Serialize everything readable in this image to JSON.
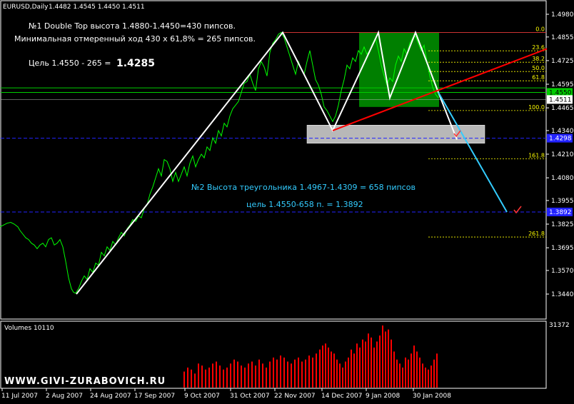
{
  "header": {
    "symbol_label": "EURUSD,Daily",
    "ohlc": "1.4482 1.4545 1.4450 1.4511"
  },
  "annotations": {
    "line1": "№1 Double Top высота 1.4880-1.4450=430 пипсов.",
    "line2": "Минимальная отмеренный ход 430 х 61,8% = 265 пипсов.",
    "target1_prefix": "Цель 1.4550 - 265 =",
    "target1_value": "1.4285",
    "line3": "№2 Высота треугольника 1.4967-1.4309 = 658 пипсов",
    "line4": "цель 1.4550-658 п. = 1.3892"
  },
  "site_label": "WWW.GIVI-ZURABOVICH.RU",
  "volume_label": "Volumes 10110",
  "colors": {
    "background": "#000000",
    "price": "#00ff00",
    "grid": "#ffffff",
    "pattern": "#ffffff",
    "trendline": "#ff0000",
    "projection": "#33ccff",
    "zone_green": "#00aa00",
    "zone_grey": "#d8d8d8",
    "fib": "#ffff00",
    "volume": "#ff0000",
    "blue_level": "#3333ff",
    "tag_green": "#00cc00",
    "tag_blue": "#2222ff"
  },
  "chart_data": {
    "type": "line",
    "title": "EURUSD,Daily",
    "ylim": [
      1.332,
      1.5
    ],
    "x_ticks": [
      "11 Jul 2007",
      "2 Aug 2007",
      "24 Aug 2007",
      "17 Sep 2007",
      "9 Oct 2007",
      "31 Oct 2007",
      "22 Nov 2007",
      "14 Dec 2007",
      "9 Jan 2008",
      "30 Jan 2008"
    ],
    "y_ticks": [
      "1.4980",
      "1.4855",
      "1.4725",
      "1.4595",
      "1.4465",
      "1.4340",
      "1.4210",
      "1.4080",
      "1.3955",
      "1.3825",
      "1.3695",
      "1.3570",
      "1.3440"
    ],
    "y_tick_values": [
      1.498,
      1.4855,
      1.4725,
      1.4595,
      1.4465,
      1.434,
      1.421,
      1.408,
      1.3955,
      1.3825,
      1.3695,
      1.357,
      1.344
    ],
    "tags": [
      {
        "label": "1.4550",
        "value": 1.455,
        "color": "#00cc00",
        "kind": "hline"
      },
      {
        "label": "1.4511",
        "value": 1.4511,
        "color": "#ffffff",
        "kind": "price"
      },
      {
        "label": "1.4298",
        "value": 1.4298,
        "color": "#2222ff",
        "kind": "hline"
      },
      {
        "label": "1.3892",
        "value": 1.3892,
        "color": "#2222ff",
        "kind": "hline"
      }
    ],
    "fib_levels": [
      {
        "label": "0.0",
        "value": 1.488
      },
      {
        "label": "23.6",
        "value": 1.4779
      },
      {
        "label": "38.2",
        "value": 1.4716
      },
      {
        "label": "50.0",
        "value": 1.4665
      },
      {
        "label": "61.8",
        "value": 1.4614
      },
      {
        "label": "100.0",
        "value": 1.445
      },
      {
        "label": "161.8",
        "value": 1.4184
      },
      {
        "label": "261.8",
        "value": 1.3754
      }
    ],
    "price": [
      [
        0,
        1.381
      ],
      [
        5,
        1.382
      ],
      [
        10,
        1.383
      ],
      [
        15,
        1.3835
      ],
      [
        20,
        1.3825
      ],
      [
        25,
        1.381
      ],
      [
        28,
        1.379
      ],
      [
        32,
        1.377
      ],
      [
        36,
        1.375
      ],
      [
        40,
        1.374
      ],
      [
        44,
        1.372
      ],
      [
        48,
        1.371
      ],
      [
        52,
        1.369
      ],
      [
        56,
        1.371
      ],
      [
        60,
        1.372
      ],
      [
        64,
        1.37
      ],
      [
        68,
        1.374
      ],
      [
        72,
        1.375
      ],
      [
        76,
        1.371
      ],
      [
        80,
        1.372
      ],
      [
        84,
        1.374
      ],
      [
        88,
        1.37
      ],
      [
        92,
        1.362
      ],
      [
        96,
        1.353
      ],
      [
        100,
        1.347
      ],
      [
        103,
        1.345
      ],
      [
        106,
        1.3445
      ],
      [
        110,
        1.347
      ],
      [
        114,
        1.351
      ],
      [
        118,
        1.354
      ],
      [
        122,
        1.352
      ],
      [
        126,
        1.358
      ],
      [
        130,
        1.356
      ],
      [
        134,
        1.361
      ],
      [
        138,
        1.36
      ],
      [
        142,
        1.367
      ],
      [
        146,
        1.365
      ],
      [
        150,
        1.37
      ],
      [
        154,
        1.368
      ],
      [
        158,
        1.373
      ],
      [
        162,
        1.371
      ],
      [
        166,
        1.375
      ],
      [
        170,
        1.378
      ],
      [
        174,
        1.376
      ],
      [
        178,
        1.38
      ],
      [
        182,
        1.382
      ],
      [
        186,
        1.385
      ],
      [
        190,
        1.384
      ],
      [
        194,
        1.387
      ],
      [
        198,
        1.386
      ],
      [
        202,
        1.391
      ],
      [
        206,
        1.393
      ],
      [
        210,
        1.399
      ],
      [
        214,
        1.403
      ],
      [
        218,
        1.408
      ],
      [
        222,
        1.413
      ],
      [
        226,
        1.409
      ],
      [
        230,
        1.418
      ],
      [
        234,
        1.417
      ],
      [
        238,
        1.413
      ],
      [
        242,
        1.406
      ],
      [
        246,
        1.411
      ],
      [
        250,
        1.406
      ],
      [
        254,
        1.41
      ],
      [
        258,
        1.414
      ],
      [
        262,
        1.409
      ],
      [
        266,
        1.416
      ],
      [
        270,
        1.42
      ],
      [
        274,
        1.414
      ],
      [
        278,
        1.418
      ],
      [
        282,
        1.421
      ],
      [
        286,
        1.419
      ],
      [
        290,
        1.425
      ],
      [
        294,
        1.423
      ],
      [
        298,
        1.43
      ],
      [
        302,
        1.427
      ],
      [
        306,
        1.434
      ],
      [
        310,
        1.431
      ],
      [
        314,
        1.438
      ],
      [
        318,
        1.436
      ],
      [
        322,
        1.442
      ],
      [
        326,
        1.446
      ],
      [
        330,
        1.448
      ],
      [
        334,
        1.45
      ],
      [
        338,
        1.455
      ],
      [
        342,
        1.46
      ],
      [
        346,
        1.461
      ],
      [
        350,
        1.465
      ],
      [
        354,
        1.46
      ],
      [
        358,
        1.456
      ],
      [
        362,
        1.468
      ],
      [
        366,
        1.472
      ],
      [
        370,
        1.469
      ],
      [
        374,
        1.464
      ],
      [
        378,
        1.477
      ],
      [
        382,
        1.482
      ],
      [
        386,
        1.484
      ],
      [
        390,
        1.487
      ],
      [
        394,
        1.488
      ],
      [
        398,
        1.485
      ],
      [
        402,
        1.48
      ],
      [
        406,
        1.475
      ],
      [
        410,
        1.47
      ],
      [
        414,
        1.465
      ],
      [
        418,
        1.472
      ],
      [
        422,
        1.468
      ],
      [
        426,
        1.465
      ],
      [
        430,
        1.472
      ],
      [
        434,
        1.478
      ],
      [
        438,
        1.47
      ],
      [
        442,
        1.462
      ],
      [
        446,
        1.459
      ],
      [
        450,
        1.454
      ],
      [
        454,
        1.447
      ],
      [
        458,
        1.445
      ],
      [
        462,
        1.442
      ],
      [
        466,
        1.439
      ],
      [
        470,
        1.442
      ],
      [
        474,
        1.448
      ],
      [
        478,
        1.456
      ],
      [
        482,
        1.462
      ],
      [
        486,
        1.47
      ],
      [
        490,
        1.468
      ],
      [
        494,
        1.474
      ],
      [
        498,
        1.472
      ],
      [
        502,
        1.478
      ],
      [
        506,
        1.476
      ],
      [
        510,
        1.48
      ],
      [
        514,
        1.476
      ],
      [
        518,
        1.478
      ],
      [
        522,
        1.482
      ],
      [
        526,
        1.485
      ],
      [
        530,
        1.478
      ],
      [
        534,
        1.47
      ],
      [
        538,
        1.464
      ],
      [
        542,
        1.459
      ],
      [
        546,
        1.463
      ],
      [
        550,
        1.461
      ],
      [
        554,
        1.47
      ],
      [
        558,
        1.475
      ],
      [
        562,
        1.472
      ],
      [
        566,
        1.479
      ],
      [
        570,
        1.476
      ],
      [
        574,
        1.482
      ],
      [
        578,
        1.485
      ],
      [
        582,
        1.486
      ],
      [
        586,
        1.482
      ],
      [
        590,
        1.478
      ],
      [
        594,
        1.481
      ],
      [
        598,
        1.472
      ],
      [
        602,
        1.464
      ],
      [
        606,
        1.458
      ],
      [
        610,
        1.454
      ],
      [
        614,
        1.452
      ]
    ],
    "pattern_lines": [
      [
        [
          107,
          1.344
        ],
        [
          396,
          1.488
        ],
        [
          466,
          1.434
        ],
        [
          530,
          1.488
        ],
        [
          546,
          1.452
        ],
        [
          582,
          1.488
        ],
        [
          614,
          1.455
        ]
      ],
      [
        [
          614,
          1.455
        ],
        [
          640,
          1.429
        ]
      ]
    ],
    "trendline": [
      [
        466,
        1.434
      ],
      [
        766,
        1.479
      ]
    ],
    "projection": [
      [
        614,
        1.455
      ],
      [
        710,
        1.3892
      ]
    ],
    "green_zone": {
      "x0": 503,
      "x1": 615,
      "y0": 1.488,
      "y1": 1.447
    },
    "grey_zone": {
      "x0": 430,
      "x1": 679,
      "y0": 1.437,
      "y1": 1.427
    },
    "volume": {
      "max_label": "31372",
      "max": 31372,
      "bars": [
        [
          258,
          8000
        ],
        [
          263,
          10000
        ],
        [
          268,
          9000
        ],
        [
          273,
          7000
        ],
        [
          278,
          12000
        ],
        [
          283,
          11000
        ],
        [
          288,
          9000
        ],
        [
          293,
          10000
        ],
        [
          298,
          12000
        ],
        [
          303,
          13000
        ],
        [
          308,
          11000
        ],
        [
          313,
          9000
        ],
        [
          318,
          10000
        ],
        [
          323,
          12000
        ],
        [
          328,
          14000
        ],
        [
          333,
          13000
        ],
        [
          338,
          11000
        ],
        [
          343,
          10000
        ],
        [
          348,
          12000
        ],
        [
          353,
          13000
        ],
        [
          358,
          11000
        ],
        [
          363,
          14000
        ],
        [
          368,
          12000
        ],
        [
          373,
          10000
        ],
        [
          378,
          13000
        ],
        [
          383,
          15000
        ],
        [
          388,
          14000
        ],
        [
          393,
          16000
        ],
        [
          398,
          15000
        ],
        [
          403,
          13000
        ],
        [
          408,
          12000
        ],
        [
          413,
          14000
        ],
        [
          418,
          15000
        ],
        [
          423,
          13000
        ],
        [
          428,
          14000
        ],
        [
          433,
          16000
        ],
        [
          438,
          15000
        ],
        [
          443,
          17000
        ],
        [
          448,
          19000
        ],
        [
          452,
          21000
        ],
        [
          456,
          22000
        ],
        [
          460,
          20000
        ],
        [
          464,
          18000
        ],
        [
          468,
          17000
        ],
        [
          472,
          14000
        ],
        [
          476,
          12000
        ],
        [
          480,
          10000
        ],
        [
          484,
          13000
        ],
        [
          488,
          15000
        ],
        [
          492,
          19000
        ],
        [
          496,
          17000
        ],
        [
          500,
          22000
        ],
        [
          504,
          20000
        ],
        [
          508,
          24000
        ],
        [
          512,
          23000
        ],
        [
          516,
          27000
        ],
        [
          520,
          25000
        ],
        [
          524,
          20000
        ],
        [
          528,
          23000
        ],
        [
          532,
          26000
        ],
        [
          536,
          31000
        ],
        [
          540,
          28000
        ],
        [
          544,
          29000
        ],
        [
          548,
          24000
        ],
        [
          552,
          18000
        ],
        [
          556,
          14000
        ],
        [
          560,
          12000
        ],
        [
          564,
          10000
        ],
        [
          568,
          15000
        ],
        [
          572,
          14000
        ],
        [
          576,
          17000
        ],
        [
          580,
          21000
        ],
        [
          584,
          18000
        ],
        [
          588,
          15000
        ],
        [
          592,
          12000
        ],
        [
          596,
          10000
        ],
        [
          600,
          9000
        ],
        [
          604,
          11000
        ],
        [
          608,
          14000
        ],
        [
          612,
          17000
        ]
      ]
    }
  }
}
